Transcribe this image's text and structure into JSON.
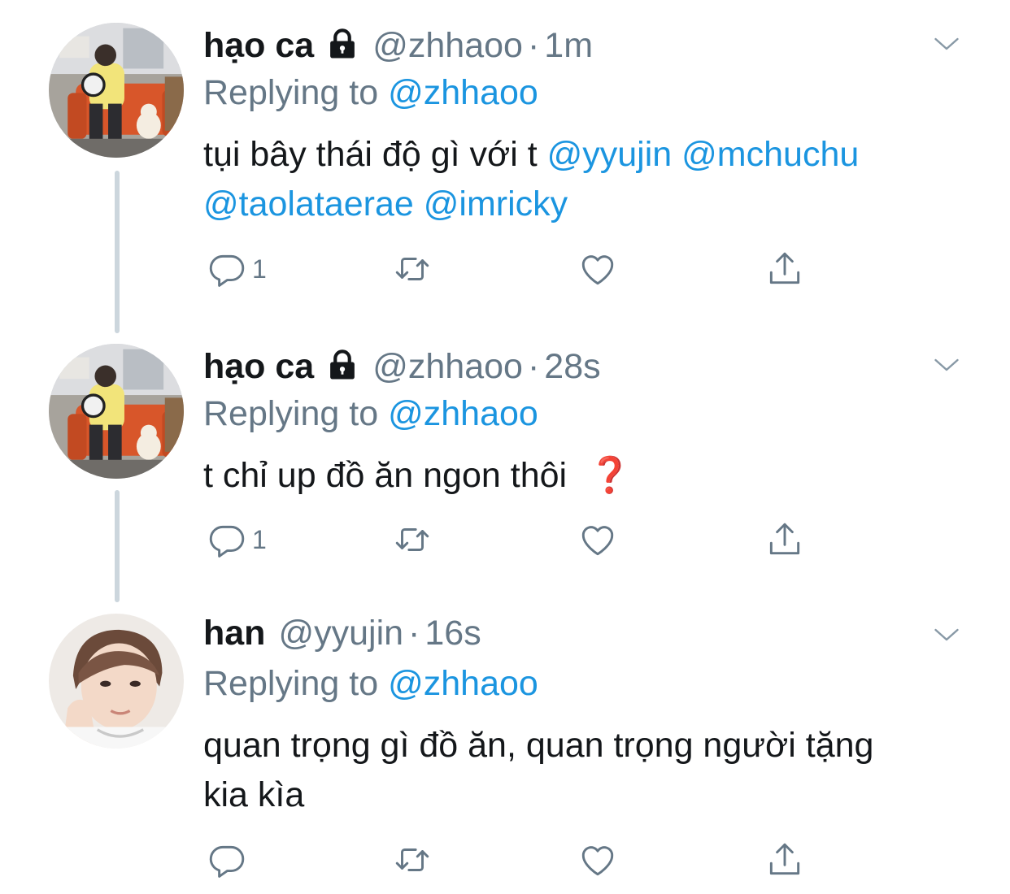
{
  "tweets": [
    {
      "name": "hạo ca",
      "handle": "@zhhaoo",
      "separator": "·",
      "time": "1m",
      "replying_prefix": "Replying to",
      "replying_handle": "@zhhaoo",
      "text_plain": "tụi bây thái độ gì với t",
      "mentions_line1": "@yyujin @mchuchu",
      "mentions_line2": "@taolataerae @imricky",
      "reply_count": "1",
      "locked": true,
      "avatar": "person-on-orange-sofa-with-dog"
    },
    {
      "name": "hạo ca",
      "handle": "@zhhaoo",
      "separator": "·",
      "time": "28s",
      "replying_prefix": "Replying to",
      "replying_handle": "@zhhaoo",
      "text_plain": "t chỉ up đồ ăn ngon thôi",
      "emoji": "❓",
      "reply_count": "1",
      "locked": true,
      "avatar": "person-on-orange-sofa-with-dog"
    },
    {
      "name": "han",
      "handle": "@yyujin",
      "separator": "·",
      "time": "16s",
      "replying_prefix": "Replying to",
      "replying_handle": "@zhhaoo",
      "text_line1": "quan trọng gì đồ ăn, quan trọng người tặng",
      "text_line2": "kia kìa",
      "reply_count": "",
      "locked": false,
      "avatar": "person-portrait-closeup"
    }
  ],
  "icons": {
    "reply": "reply-icon",
    "retweet": "retweet-icon",
    "like": "like-icon",
    "share": "share-icon",
    "more": "chevron-down-icon",
    "lock": "lock-icon"
  },
  "colors": {
    "link": "#1b95e0",
    "secondary": "#657786",
    "primary_text": "#14171a",
    "thread_line": "#ccd6dd"
  }
}
